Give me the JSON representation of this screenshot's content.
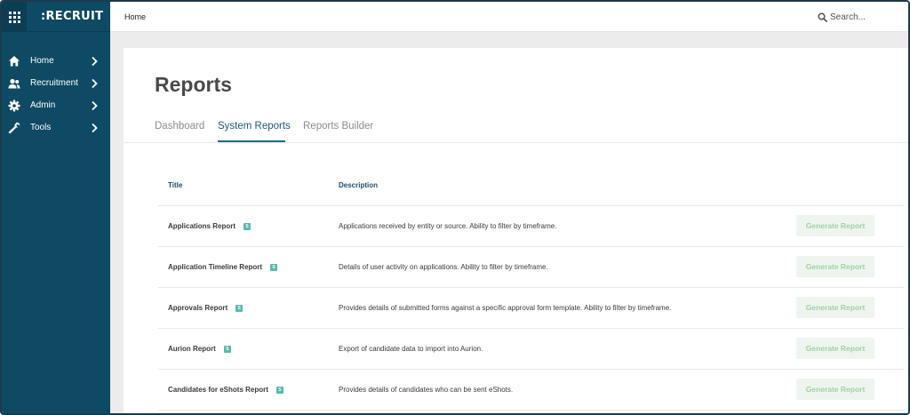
{
  "brand": {
    "logo": ":RECRUIT",
    "color": "#0e4a63"
  },
  "sidebar": {
    "items": [
      {
        "label": "Home",
        "icon": "home-icon"
      },
      {
        "label": "Recruitment",
        "icon": "people-icon"
      },
      {
        "label": "Admin",
        "icon": "gear-icon"
      },
      {
        "label": "Tools",
        "icon": "wrench-icon"
      }
    ]
  },
  "topbar": {
    "breadcrumb": "Home",
    "search_placeholder": "Search..."
  },
  "page": {
    "title": "Reports",
    "tabs": [
      {
        "label": "Dashboard",
        "active": false
      },
      {
        "label": "System Reports",
        "active": true
      },
      {
        "label": "Reports Builder",
        "active": false
      }
    ]
  },
  "table": {
    "headers": {
      "title": "Title",
      "description": "Description"
    },
    "button_label": "Generate Report",
    "badge_label": "S",
    "rows": [
      {
        "title": "Applications Report",
        "description": "Applications received by entity or source. Ability to filter by timeframe."
      },
      {
        "title": "Application Timeline Report",
        "description": "Details of user activity on applications. Ability to filter by timeframe."
      },
      {
        "title": "Approvals Report",
        "description": "Provides details of submitted forms against a specific approval form template. Ability to filter by timeframe."
      },
      {
        "title": "Aurion Report",
        "description": "Export of candidate data to import into Aurion."
      },
      {
        "title": "Candidates for eShots Report",
        "description": "Provides details of candidates who can be sent eShots."
      }
    ]
  },
  "colors": {
    "accent": "#1d6a83",
    "badge": "#5ab8b0",
    "button_text": "#9fd3a3",
    "button_bg": "#eef5ee"
  }
}
